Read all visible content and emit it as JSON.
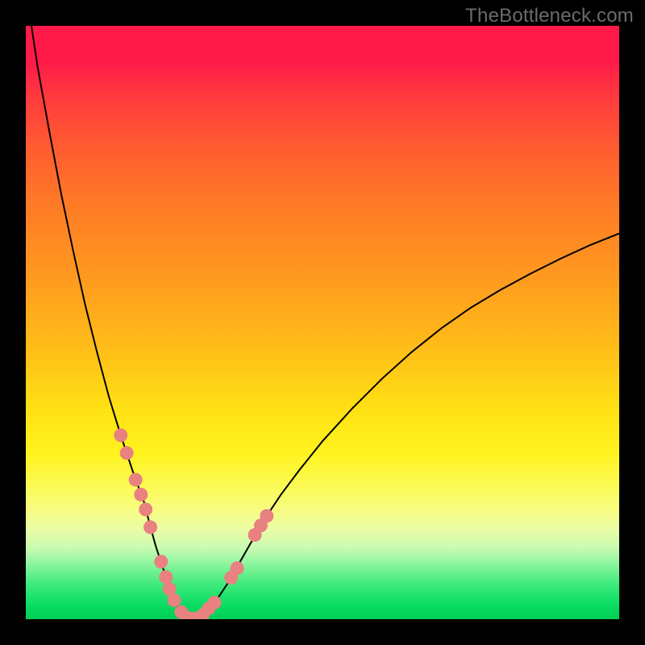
{
  "watermark": "TheBottleneck.com",
  "chart_data": {
    "type": "line",
    "title": "",
    "xlabel": "",
    "ylabel": "",
    "xlim": [
      0,
      100
    ],
    "ylim": [
      0,
      100
    ],
    "annotations": [],
    "gradient_stops": [
      {
        "pos": 0,
        "color": "#ff1a4a"
      },
      {
        "pos": 30,
        "color": "#ff7a26"
      },
      {
        "pos": 60,
        "color": "#ffe214"
      },
      {
        "pos": 80,
        "color": "#f6fc86"
      },
      {
        "pos": 92,
        "color": "#6ef18f"
      },
      {
        "pos": 100,
        "color": "#00cf56"
      }
    ],
    "series": [
      {
        "name": "bottleneck-curve",
        "x": [
          0.5,
          2,
          4,
          6,
          8,
          10,
          12,
          14,
          16,
          18,
          20,
          21,
          22,
          23,
          23.8,
          24.6,
          25.4,
          26.2,
          27,
          28,
          29,
          30,
          32,
          34,
          36,
          38,
          40,
          43,
          46,
          50,
          55,
          60,
          65,
          70,
          75,
          80,
          85,
          90,
          95,
          100
        ],
        "y": [
          103,
          93,
          82,
          71.5,
          62,
          53,
          45,
          37.5,
          31,
          25,
          19.5,
          15.5,
          12,
          9,
          6.5,
          4.2,
          2.4,
          1.2,
          0.4,
          0,
          0.2,
          0.9,
          3,
          6,
          9.5,
          13,
          16.5,
          21,
          25,
          30,
          35.5,
          40.5,
          45,
          49,
          52.5,
          55.5,
          58.2,
          60.7,
          63,
          65
        ]
      }
    ],
    "highlight_points": {
      "name": "highlighted-samples",
      "color": "#e98181",
      "radius_px": 8.5,
      "points": [
        {
          "x": 16.0,
          "y": 31.0
        },
        {
          "x": 17.0,
          "y": 28.0
        },
        {
          "x": 18.5,
          "y": 23.5
        },
        {
          "x": 19.4,
          "y": 21.0
        },
        {
          "x": 20.2,
          "y": 18.5
        },
        {
          "x": 21.0,
          "y": 15.5
        },
        {
          "x": 22.8,
          "y": 9.7
        },
        {
          "x": 23.6,
          "y": 7.1
        },
        {
          "x": 24.2,
          "y": 5.1
        },
        {
          "x": 25.0,
          "y": 3.2
        },
        {
          "x": 26.2,
          "y": 1.2
        },
        {
          "x": 27.4,
          "y": 0.2
        },
        {
          "x": 28.6,
          "y": 0.1
        },
        {
          "x": 29.8,
          "y": 0.7
        },
        {
          "x": 30.8,
          "y": 1.8
        },
        {
          "x": 31.8,
          "y": 2.8
        },
        {
          "x": 34.6,
          "y": 7.0
        },
        {
          "x": 35.6,
          "y": 8.6
        },
        {
          "x": 38.6,
          "y": 14.2
        },
        {
          "x": 39.6,
          "y": 15.8
        },
        {
          "x": 40.6,
          "y": 17.4
        }
      ]
    }
  }
}
